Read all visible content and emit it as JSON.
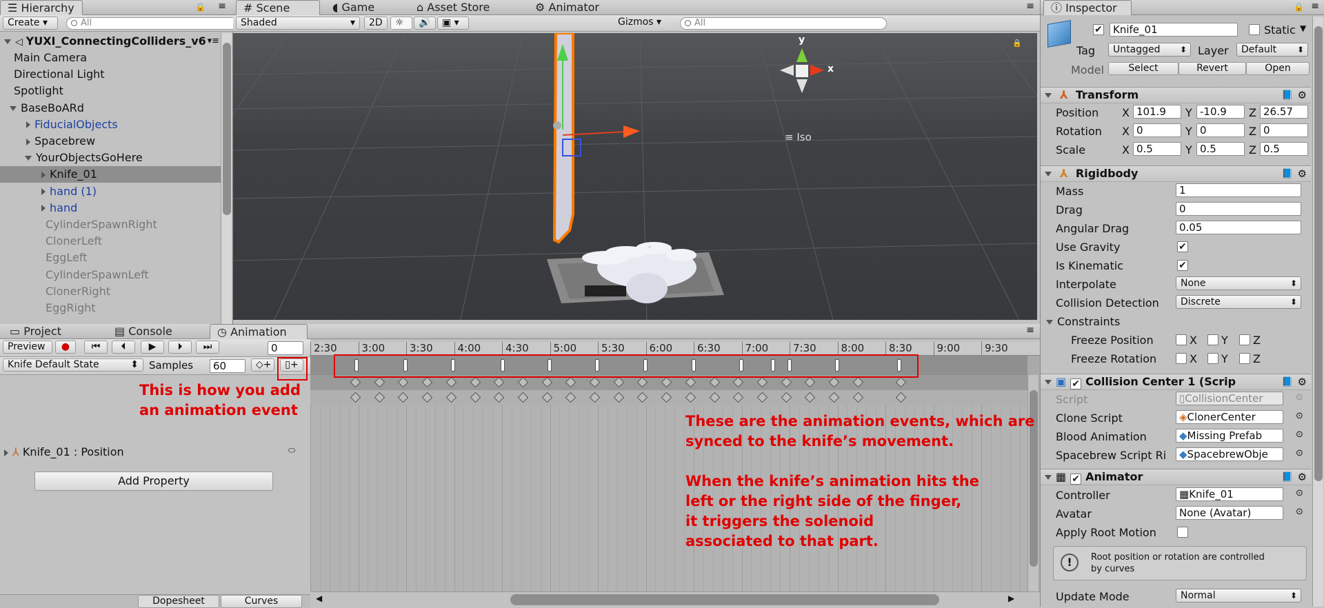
{
  "hierarchy": {
    "tab": "Hierarchy",
    "create": "Create",
    "search_placeholder": "All",
    "scene_name": "YUXI_ConnectingColliders_v6",
    "items": [
      {
        "label": "Main Camera",
        "indent": 0,
        "kind": "normal",
        "arrow": "none"
      },
      {
        "label": "Directional Light",
        "indent": 0,
        "kind": "normal",
        "arrow": "none"
      },
      {
        "label": "Spotlight",
        "indent": 0,
        "kind": "normal",
        "arrow": "none"
      },
      {
        "label": "BaseBoARd",
        "indent": 0,
        "kind": "normal",
        "arrow": "down"
      },
      {
        "label": "FiducialObjects",
        "indent": 1,
        "kind": "prefab",
        "arrow": "right"
      },
      {
        "label": "Spacebrew",
        "indent": 1,
        "kind": "normal",
        "arrow": "right"
      },
      {
        "label": "YourObjectsGoHere",
        "indent": 1,
        "kind": "normal",
        "arrow": "down"
      },
      {
        "label": "Knife_01",
        "indent": 2,
        "kind": "selected",
        "arrow": "right"
      },
      {
        "label": "hand (1)",
        "indent": 2,
        "kind": "prefab",
        "arrow": "right"
      },
      {
        "label": "hand",
        "indent": 2,
        "kind": "prefab",
        "arrow": "right"
      },
      {
        "label": "CylinderSpawnRight",
        "indent": 2,
        "kind": "dim",
        "arrow": "none"
      },
      {
        "label": "ClonerLeft",
        "indent": 2,
        "kind": "dim",
        "arrow": "none"
      },
      {
        "label": "EggLeft",
        "indent": 2,
        "kind": "dim",
        "arrow": "none"
      },
      {
        "label": "CylinderSpawnLeft",
        "indent": 2,
        "kind": "dim",
        "arrow": "none"
      },
      {
        "label": "ClonerRight",
        "indent": 2,
        "kind": "dim",
        "arrow": "none"
      },
      {
        "label": "EggRight",
        "indent": 2,
        "kind": "dim",
        "arrow": "none"
      }
    ]
  },
  "scene": {
    "tabs": [
      "Scene",
      "Game",
      "Asset Store",
      "Animator"
    ],
    "shading": "Shaded",
    "mode_2d": "2D",
    "gizmos": "Gizmos",
    "search_placeholder": "All",
    "gizmo_y": "y",
    "gizmo_x": "x",
    "projection": "Iso"
  },
  "bottom_tabs": [
    "Project",
    "Console",
    "Animation"
  ],
  "animation": {
    "preview": "Preview",
    "frame": "0",
    "clip": "Knife Default State",
    "samples_label": "Samples",
    "samples": "60",
    "property": "Knife_01 : Position",
    "add_property": "Add Property",
    "dopesheet": "Dopesheet",
    "curves": "Curves",
    "ruler": [
      "2:30",
      "3:00",
      "3:30",
      "4:00",
      "4:30",
      "5:00",
      "5:30",
      "6:00",
      "6:30",
      "7:00",
      "7:30",
      "8:00",
      "8:30",
      "9:00",
      "9:30"
    ]
  },
  "annotations": {
    "add_event_1": "This is how you add",
    "add_event_2": "an animation event",
    "events_1": "These are the animation events, which are",
    "events_2": "synced to the knife’s movement.",
    "events_3": "When the knife’s animation hits the",
    "events_4": "left or the right side of the finger,",
    "events_5": "it triggers the solenoid",
    "events_6": "associated to that part.",
    "color": "#e00000"
  },
  "inspector": {
    "tab": "Inspector",
    "object_name": "Knife_01",
    "static": "Static",
    "tag_label": "Tag",
    "tag": "Untagged",
    "layer_label": "Layer",
    "layer": "Default",
    "model_label": "Model",
    "select": "Select",
    "revert": "Revert",
    "open": "Open",
    "transform": {
      "title": "Transform",
      "position": {
        "label": "Position",
        "x": "101.9",
        "y": "-10.9",
        "z": "26.57"
      },
      "rotation": {
        "label": "Rotation",
        "x": "0",
        "y": "0",
        "z": "0"
      },
      "scale": {
        "label": "Scale",
        "x": "0.5",
        "y": "0.5",
        "z": "0.5"
      }
    },
    "rigidbody": {
      "title": "Rigidbody",
      "mass_label": "Mass",
      "mass": "1",
      "drag_label": "Drag",
      "drag": "0",
      "angular_label": "Angular Drag",
      "angular": "0.05",
      "gravity_label": "Use Gravity",
      "kinematic_label": "Is Kinematic",
      "interpolate_label": "Interpolate",
      "interpolate": "None",
      "collision_label": "Collision Detection",
      "collision": "Discrete",
      "constraints_label": "Constraints",
      "freeze_pos": "Freeze Position",
      "freeze_rot": "Freeze Rotation"
    },
    "collision_center": {
      "title": "Collision Center 1 (Scrip",
      "script_label": "Script",
      "script": "CollisionCenter",
      "clone_label": "Clone Script",
      "clone": "ClonerCenter",
      "blood_label": "Blood Animation",
      "blood": "Missing Prefab",
      "spacebrew_label": "Spacebrew Script Ri",
      "spacebrew": "SpacebrewObje"
    },
    "animator": {
      "title": "Animator",
      "controller_label": "Controller",
      "controller": "Knife_01",
      "avatar_label": "Avatar",
      "avatar": "None (Avatar)",
      "root_label": "Apply Root Motion",
      "info_1": "Root position or rotation are controlled",
      "info_2": "by curves",
      "update_label": "Update Mode",
      "update": "Normal"
    }
  }
}
